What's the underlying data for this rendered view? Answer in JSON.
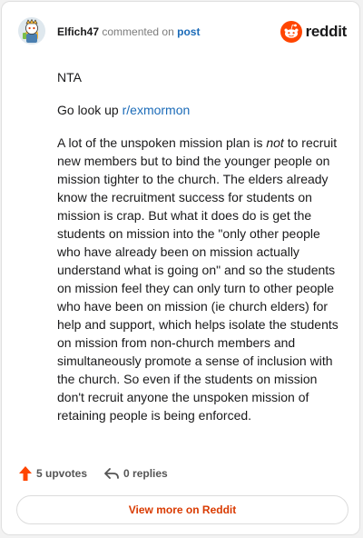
{
  "comment": {
    "username": "Elfich47",
    "action_text": "commented on",
    "post_link": "post"
  },
  "brand": {
    "wordmark": "reddit",
    "color": "#ff4500"
  },
  "body": {
    "paragraph1": "NTA",
    "paragraph2_prefix": "Go look up ",
    "paragraph2_link": "r/exmormon",
    "paragraph3_part1": "A lot of the unspoken mission plan is ",
    "paragraph3_emphasis": "not",
    "paragraph3_part2": " to recruit new members but to bind the younger people on mission tighter to the church. The elders already know the recruitment success for students on mission is crap. But what it does do is get the students on mission into the \"only other people who have already been on mission actually understand what is going on\" and so the students on mission feel they can only turn to other people who have been on mission (ie church elders) for help and support, which helps isolate the students on mission from non-church members and simultaneously promote a sense of inclusion with the church. So even if the students on mission don't recruit anyone the unspoken mission of retaining people is being enforced."
  },
  "footer": {
    "upvotes": "5 upvotes",
    "replies": "0 replies",
    "upvote_color": "#ff4500"
  },
  "view_button": {
    "label": "View more on Reddit",
    "color": "#d93a00"
  },
  "icons": {
    "avatar": "snoo-avatar-icon",
    "brand": "reddit-snoo-icon",
    "upvote": "upvote-arrow-icon",
    "reply": "reply-arrow-icon"
  }
}
